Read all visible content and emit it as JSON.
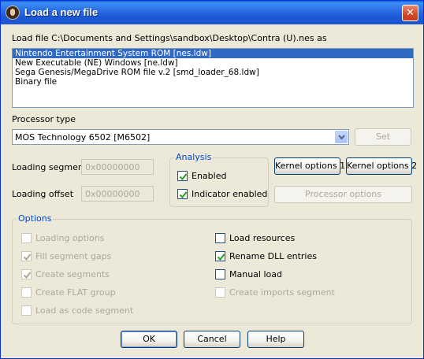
{
  "window": {
    "title": "Load a new file",
    "close_symbol": "✕"
  },
  "load_file_label": "Load file C:\\Documents and Settings\\sandbox\\Desktop\\Contra (U).nes as",
  "loaders": [
    {
      "label": "Nintendo Entertainment System ROM [nes.ldw]",
      "selected": true
    },
    {
      "label": "New Executable (NE) Windows [ne.ldw]",
      "selected": false
    },
    {
      "label": "Sega Genesis/MegaDrive ROM file v.2 [smd_loader_68.ldw]",
      "selected": false
    },
    {
      "label": "Binary file",
      "selected": false
    }
  ],
  "processor": {
    "label": "Processor type",
    "value": "MOS Technology 6502 [M6502]",
    "set_label": "Set"
  },
  "loading": {
    "segment_label": "Loading segment",
    "segment_value": "0x00000000",
    "offset_label": "Loading offset",
    "offset_value": "0x00000000"
  },
  "analysis": {
    "title": "Analysis",
    "enabled_label": "Enabled",
    "enabled": true,
    "indicator_label": "Indicator enabled",
    "indicator": true
  },
  "kernel_options_1": "Kernel options 1",
  "kernel_options_2": "Kernel options 2",
  "processor_options_label": "Processor options",
  "options": {
    "title": "Options",
    "left": [
      {
        "label": "Loading options",
        "checked": false,
        "enabled": false
      },
      {
        "label": "Fill segment gaps",
        "checked": true,
        "enabled": false
      },
      {
        "label": "Create segments",
        "checked": true,
        "enabled": false
      },
      {
        "label": "Create FLAT group",
        "checked": false,
        "enabled": false
      },
      {
        "label": "Load as code segment",
        "checked": false,
        "enabled": false
      }
    ],
    "right": [
      {
        "label": "Load resources",
        "checked": false,
        "enabled": true
      },
      {
        "label": "Rename DLL entries",
        "checked": true,
        "enabled": true
      },
      {
        "label": "Manual load",
        "checked": false,
        "enabled": true
      },
      {
        "label": "Create imports segment",
        "checked": false,
        "enabled": false
      }
    ]
  },
  "buttons": {
    "ok": "OK",
    "cancel": "Cancel",
    "help": "Help"
  },
  "colors": {
    "accent": "#316ac5",
    "group_title": "#0046d5",
    "titlebar": "#1c58d4",
    "check": "#21a121"
  }
}
